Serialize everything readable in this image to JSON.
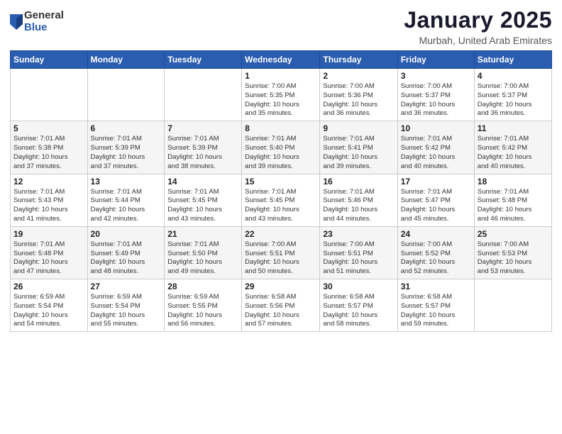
{
  "header": {
    "logo": {
      "general": "General",
      "blue": "Blue"
    },
    "title": "January 2025",
    "location": "Murbah, United Arab Emirates"
  },
  "calendar": {
    "days_of_week": [
      "Sunday",
      "Monday",
      "Tuesday",
      "Wednesday",
      "Thursday",
      "Friday",
      "Saturday"
    ],
    "weeks": [
      [
        {
          "day": "",
          "info": ""
        },
        {
          "day": "",
          "info": ""
        },
        {
          "day": "",
          "info": ""
        },
        {
          "day": "1",
          "info": "Sunrise: 7:00 AM\nSunset: 5:35 PM\nDaylight: 10 hours\nand 35 minutes."
        },
        {
          "day": "2",
          "info": "Sunrise: 7:00 AM\nSunset: 5:36 PM\nDaylight: 10 hours\nand 36 minutes."
        },
        {
          "day": "3",
          "info": "Sunrise: 7:00 AM\nSunset: 5:37 PM\nDaylight: 10 hours\nand 36 minutes."
        },
        {
          "day": "4",
          "info": "Sunrise: 7:00 AM\nSunset: 5:37 PM\nDaylight: 10 hours\nand 36 minutes."
        }
      ],
      [
        {
          "day": "5",
          "info": "Sunrise: 7:01 AM\nSunset: 5:38 PM\nDaylight: 10 hours\nand 37 minutes."
        },
        {
          "day": "6",
          "info": "Sunrise: 7:01 AM\nSunset: 5:39 PM\nDaylight: 10 hours\nand 37 minutes."
        },
        {
          "day": "7",
          "info": "Sunrise: 7:01 AM\nSunset: 5:39 PM\nDaylight: 10 hours\nand 38 minutes."
        },
        {
          "day": "8",
          "info": "Sunrise: 7:01 AM\nSunset: 5:40 PM\nDaylight: 10 hours\nand 39 minutes."
        },
        {
          "day": "9",
          "info": "Sunrise: 7:01 AM\nSunset: 5:41 PM\nDaylight: 10 hours\nand 39 minutes."
        },
        {
          "day": "10",
          "info": "Sunrise: 7:01 AM\nSunset: 5:42 PM\nDaylight: 10 hours\nand 40 minutes."
        },
        {
          "day": "11",
          "info": "Sunrise: 7:01 AM\nSunset: 5:42 PM\nDaylight: 10 hours\nand 40 minutes."
        }
      ],
      [
        {
          "day": "12",
          "info": "Sunrise: 7:01 AM\nSunset: 5:43 PM\nDaylight: 10 hours\nand 41 minutes."
        },
        {
          "day": "13",
          "info": "Sunrise: 7:01 AM\nSunset: 5:44 PM\nDaylight: 10 hours\nand 42 minutes."
        },
        {
          "day": "14",
          "info": "Sunrise: 7:01 AM\nSunset: 5:45 PM\nDaylight: 10 hours\nand 43 minutes."
        },
        {
          "day": "15",
          "info": "Sunrise: 7:01 AM\nSunset: 5:45 PM\nDaylight: 10 hours\nand 43 minutes."
        },
        {
          "day": "16",
          "info": "Sunrise: 7:01 AM\nSunset: 5:46 PM\nDaylight: 10 hours\nand 44 minutes."
        },
        {
          "day": "17",
          "info": "Sunrise: 7:01 AM\nSunset: 5:47 PM\nDaylight: 10 hours\nand 45 minutes."
        },
        {
          "day": "18",
          "info": "Sunrise: 7:01 AM\nSunset: 5:48 PM\nDaylight: 10 hours\nand 46 minutes."
        }
      ],
      [
        {
          "day": "19",
          "info": "Sunrise: 7:01 AM\nSunset: 5:48 PM\nDaylight: 10 hours\nand 47 minutes."
        },
        {
          "day": "20",
          "info": "Sunrise: 7:01 AM\nSunset: 5:49 PM\nDaylight: 10 hours\nand 48 minutes."
        },
        {
          "day": "21",
          "info": "Sunrise: 7:01 AM\nSunset: 5:50 PM\nDaylight: 10 hours\nand 49 minutes."
        },
        {
          "day": "22",
          "info": "Sunrise: 7:00 AM\nSunset: 5:51 PM\nDaylight: 10 hours\nand 50 minutes."
        },
        {
          "day": "23",
          "info": "Sunrise: 7:00 AM\nSunset: 5:51 PM\nDaylight: 10 hours\nand 51 minutes."
        },
        {
          "day": "24",
          "info": "Sunrise: 7:00 AM\nSunset: 5:52 PM\nDaylight: 10 hours\nand 52 minutes."
        },
        {
          "day": "25",
          "info": "Sunrise: 7:00 AM\nSunset: 5:53 PM\nDaylight: 10 hours\nand 53 minutes."
        }
      ],
      [
        {
          "day": "26",
          "info": "Sunrise: 6:59 AM\nSunset: 5:54 PM\nDaylight: 10 hours\nand 54 minutes."
        },
        {
          "day": "27",
          "info": "Sunrise: 6:59 AM\nSunset: 5:54 PM\nDaylight: 10 hours\nand 55 minutes."
        },
        {
          "day": "28",
          "info": "Sunrise: 6:59 AM\nSunset: 5:55 PM\nDaylight: 10 hours\nand 56 minutes."
        },
        {
          "day": "29",
          "info": "Sunrise: 6:58 AM\nSunset: 5:56 PM\nDaylight: 10 hours\nand 57 minutes."
        },
        {
          "day": "30",
          "info": "Sunrise: 6:58 AM\nSunset: 5:57 PM\nDaylight: 10 hours\nand 58 minutes."
        },
        {
          "day": "31",
          "info": "Sunrise: 6:58 AM\nSunset: 5:57 PM\nDaylight: 10 hours\nand 59 minutes."
        },
        {
          "day": "",
          "info": ""
        }
      ]
    ]
  }
}
